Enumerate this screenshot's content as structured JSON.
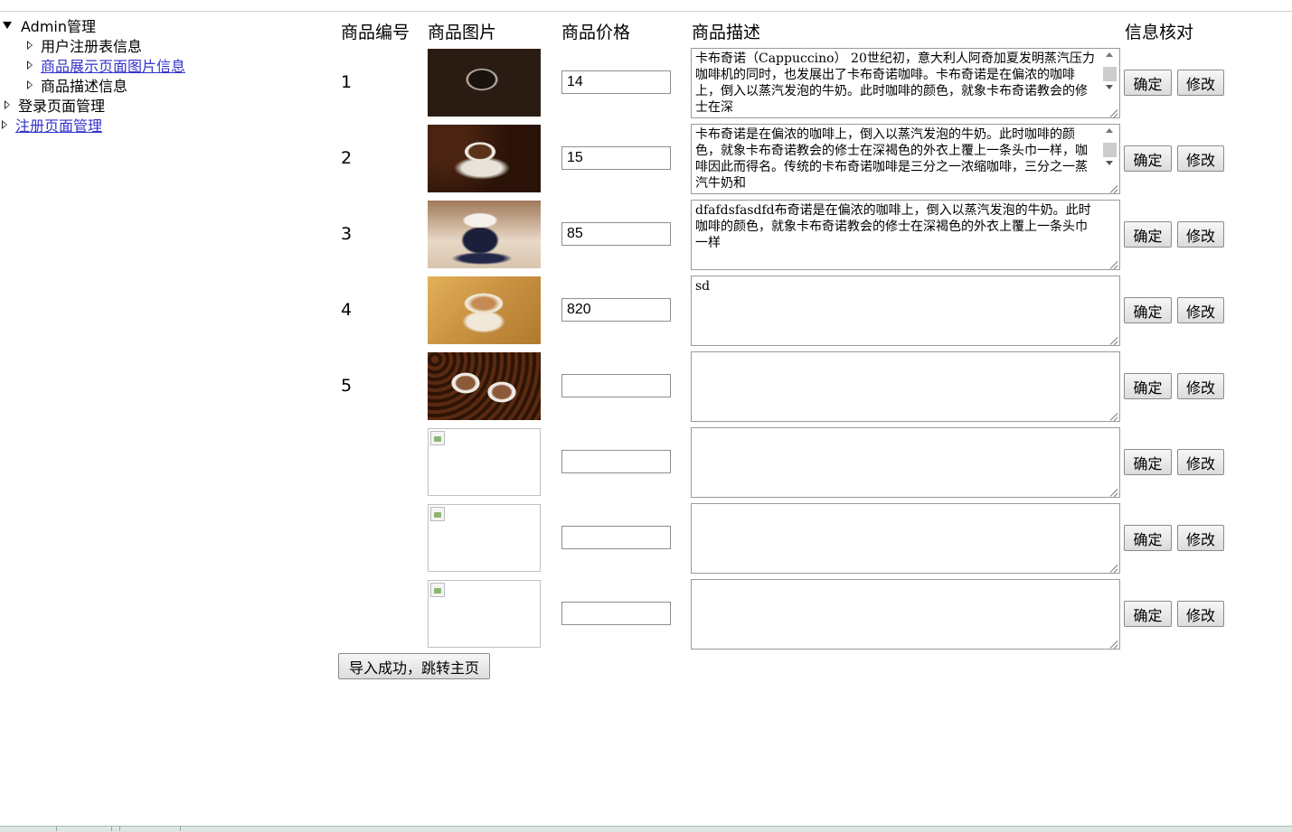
{
  "tree": {
    "root": "Admin管理",
    "children": [
      "用户注册表信息",
      "商品展示页面图片信息",
      "商品描述信息"
    ],
    "login": "登录页面管理",
    "register": "注册页面管理"
  },
  "headers": {
    "id": "商品编号",
    "image": "商品图片",
    "price": "商品价格",
    "desc": "商品描述",
    "check": "信息核对"
  },
  "buttons": {
    "confirm": "确定",
    "edit": "修改"
  },
  "rows": [
    {
      "id": "1",
      "price": "14",
      "image": "coffee-cup-dark-table",
      "desc": "卡布奇诺（Cappuccino）    20世纪初，意大利人阿奇加夏发明蒸汽压力咖啡机的同时，也发展出了卡布奇诺咖啡。卡布奇诺是在偏浓的咖啡上，倒入以蒸汽发泡的牛奶。此时咖啡的颜色，就象卡布奇诺教会的修士在深"
    },
    {
      "id": "2",
      "price": "15",
      "image": "coffee-cup-beans",
      "desc": "卡布奇诺是在偏浓的咖啡上，倒入以蒸汽发泡的牛奶。此时咖啡的颜色，就象卡布奇诺教会的修士在深褐色的外衣上覆上一条头巾一样，咖啡因此而得名。传统的卡布奇诺咖啡是三分之一浓缩咖啡，三分之一蒸汽牛奶和"
    },
    {
      "id": "3",
      "price": "85",
      "image": "coffee-cup-cream",
      "desc": "dfafdsfasdfd布奇诺是在偏浓的咖啡上，倒入以蒸汽发泡的牛奶。此时咖啡的颜色，就象卡布奇诺教会的修士在深褐色的外衣上覆上一条头巾一样"
    },
    {
      "id": "4",
      "price": "820",
      "image": "cappuccino-cup",
      "desc": "sd"
    },
    {
      "id": "5",
      "price": "",
      "image": "heart-cups-beans",
      "desc": ""
    },
    {
      "id": "",
      "price": "",
      "image": "broken-image-icon",
      "desc": ""
    },
    {
      "id": "",
      "price": "",
      "image": "broken-image-icon",
      "desc": ""
    },
    {
      "id": "",
      "price": "",
      "image": "broken-image-icon",
      "desc": ""
    }
  ],
  "import_button": "导入成功，跳转主页"
}
